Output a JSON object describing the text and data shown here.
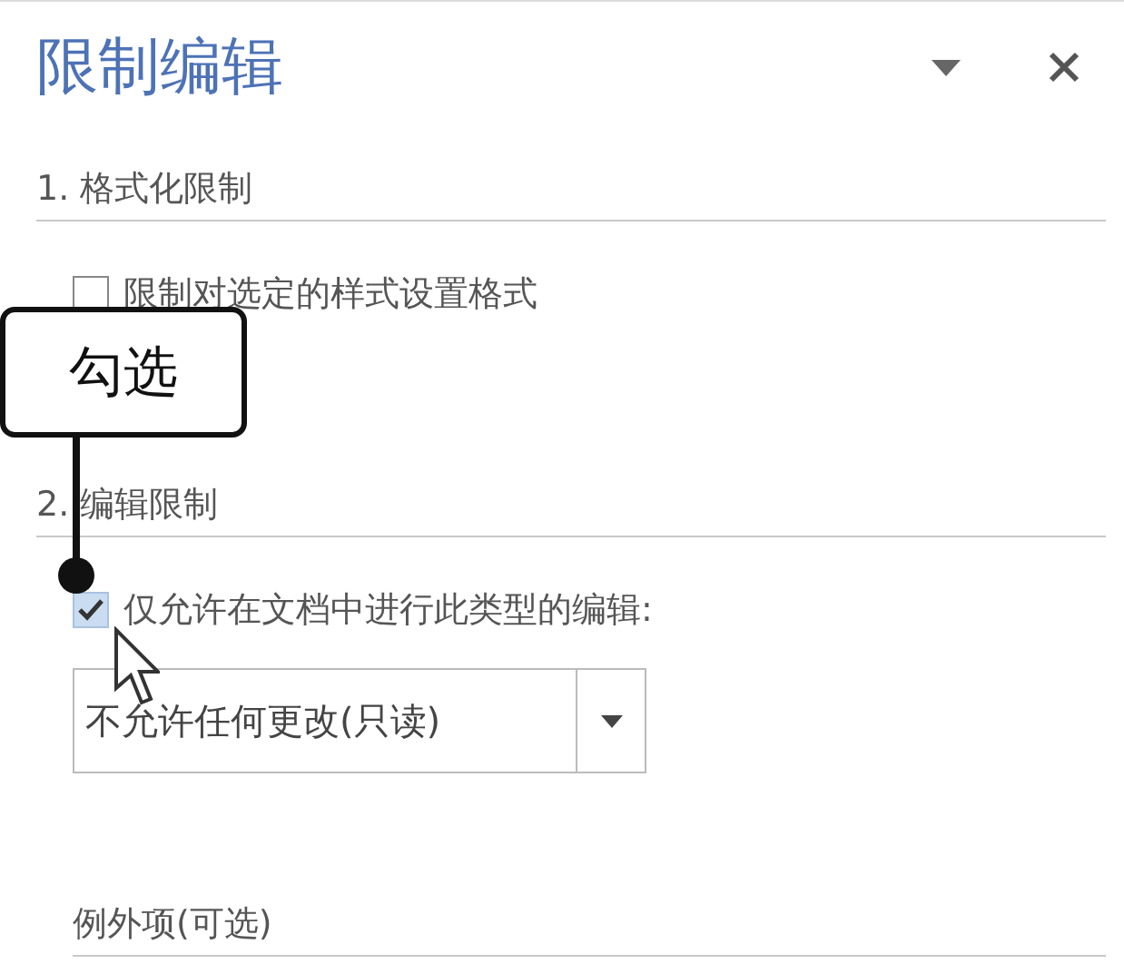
{
  "pane": {
    "title": "限制编辑"
  },
  "sections": [
    {
      "heading": "1. 格式化限制",
      "options": [
        {
          "label": "限制对选定的样式设置格式",
          "checked": false
        }
      ]
    },
    {
      "heading": "2. 编辑限制",
      "options": [
        {
          "label": "仅允许在文档中进行此类型的编辑:",
          "checked": true
        }
      ],
      "dropdown": {
        "value": "不允许任何更改(只读)"
      }
    },
    {
      "heading": "例外项(可选)"
    }
  ],
  "callout": {
    "text": "勾选"
  }
}
